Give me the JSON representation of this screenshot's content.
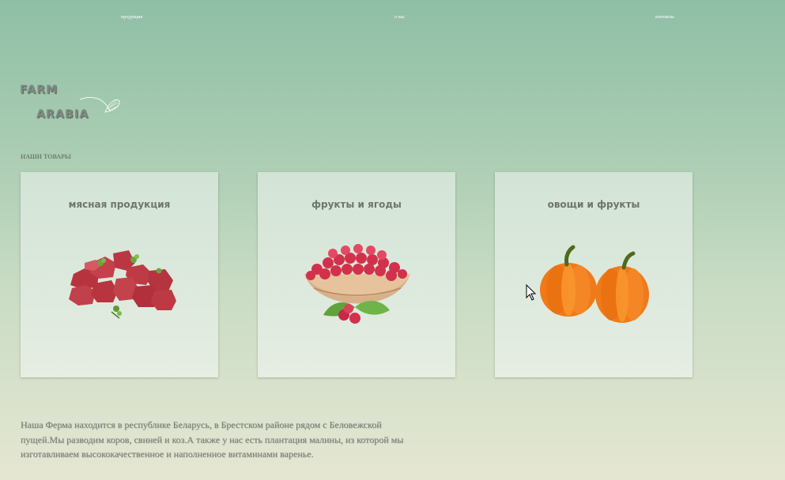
{
  "nav": {
    "items": [
      {
        "label": "продукция"
      },
      {
        "label": "о нас"
      },
      {
        "label": "контакты"
      }
    ]
  },
  "logo": {
    "line1": "FARM",
    "line2": "ARABIA"
  },
  "products": {
    "heading": "НАШИ ТОВАРЫ",
    "cards": [
      {
        "title": "мясная продукция",
        "icon": "meat-image"
      },
      {
        "title": "фрукты и ягоды",
        "icon": "raspberries-image"
      },
      {
        "title": "овощи и фрукты",
        "icon": "pumpkins-image"
      }
    ]
  },
  "about": {
    "text": "Наша Ферма находится в республике Беларусь, в Брестском районе рядом с Беловежской пущей.Мы разводим коров, свиней и коз.А также у нас есть плантация малины, из которой мы изготавливаем высококачественное и наполненное витаминами варенье."
  },
  "colors": {
    "background_top": "#8fbfa6",
    "background_bottom": "#e5e6d2",
    "card": "#dbe8dc",
    "text": "#7c7f78"
  }
}
